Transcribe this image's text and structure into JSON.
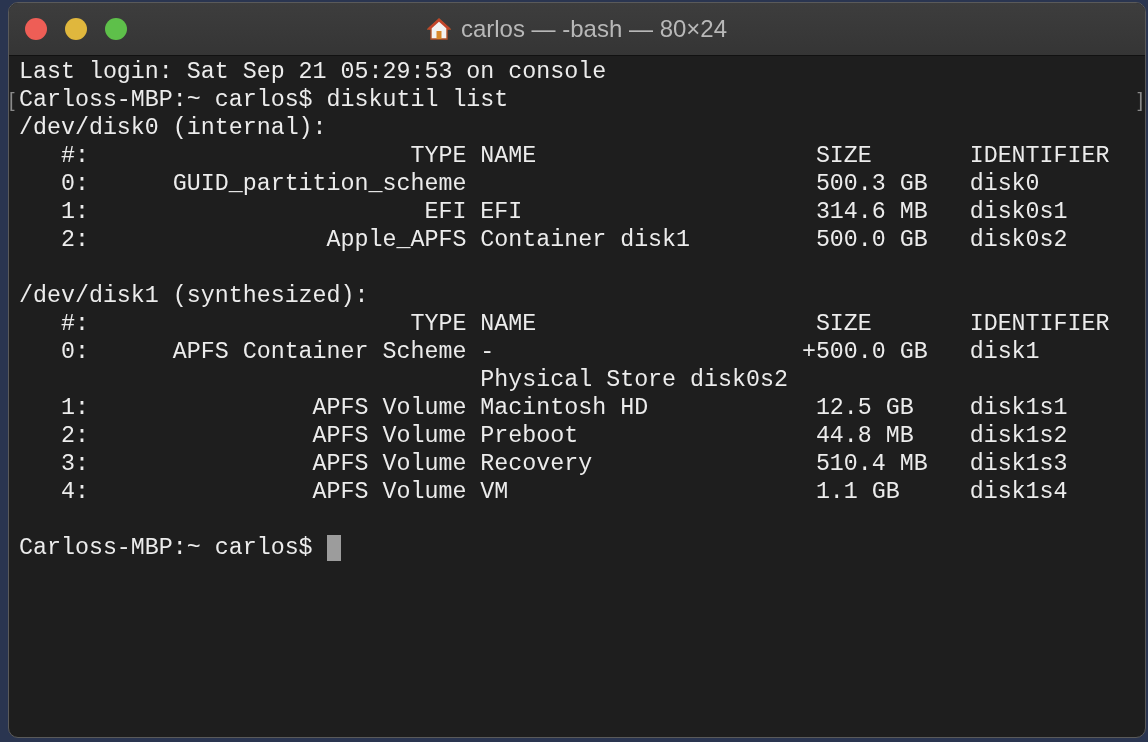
{
  "window": {
    "title": "carlos — -bash — 80×24"
  },
  "lines": [
    {
      "kind": "text",
      "text": "Last login: Sat Sep 21 05:29:53 on console"
    },
    {
      "kind": "text",
      "text": "Carloss-MBP:~ carlos$ diskutil list",
      "mark_open": "[",
      "mark_close": "]"
    },
    {
      "kind": "text",
      "text": "/dev/disk0 (internal):"
    },
    {
      "kind": "text",
      "text": "   #:                       TYPE NAME                    SIZE       IDENTIFIER"
    },
    {
      "kind": "text",
      "text": "   0:      GUID_partition_scheme                         500.3 GB   disk0"
    },
    {
      "kind": "text",
      "text": "   1:                        EFI EFI                     314.6 MB   disk0s1"
    },
    {
      "kind": "text",
      "text": "   2:                 Apple_APFS Container disk1         500.0 GB   disk0s2"
    },
    {
      "kind": "blank"
    },
    {
      "kind": "text",
      "text": "/dev/disk1 (synthesized):"
    },
    {
      "kind": "text",
      "text": "   #:                       TYPE NAME                    SIZE       IDENTIFIER"
    },
    {
      "kind": "text",
      "text": "   0:      APFS Container Scheme -                      +500.0 GB   disk1"
    },
    {
      "kind": "text",
      "text": "                                 Physical Store disk0s2"
    },
    {
      "kind": "text",
      "text": "   1:                APFS Volume Macintosh HD            12.5 GB    disk1s1"
    },
    {
      "kind": "text",
      "text": "   2:                APFS Volume Preboot                 44.8 MB    disk1s2"
    },
    {
      "kind": "text",
      "text": "   3:                APFS Volume Recovery                510.4 MB   disk1s3"
    },
    {
      "kind": "text",
      "text": "   4:                APFS Volume VM                      1.1 GB     disk1s4"
    },
    {
      "kind": "blank"
    },
    {
      "kind": "prompt",
      "text": "Carloss-MBP:~ carlos$ ",
      "cursor": true
    }
  ]
}
